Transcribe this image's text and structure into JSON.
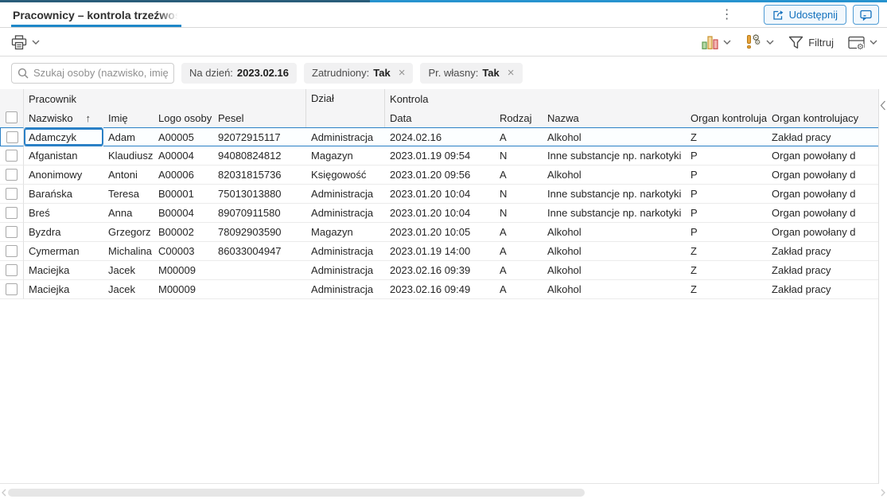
{
  "window": {
    "tab_title": "Pracownicy – kontrola trzeźwości",
    "share_label": "Udostępnij"
  },
  "toolbar": {
    "filter_label": "Filtruj"
  },
  "filters": {
    "search_placeholder": "Szukaj osoby (nazwisko, imię, l",
    "chips": [
      {
        "label": "Na dzień:",
        "value": "2023.02.16",
        "removable": false
      },
      {
        "label": "Zatrudniony:",
        "value": "Tak",
        "removable": true
      },
      {
        "label": "Pr. własny:",
        "value": "Tak",
        "removable": true
      }
    ],
    "chip_close_glyph": "×"
  },
  "table": {
    "group_headers": {
      "pracownik": "Pracownik",
      "dzial": "Dział",
      "kontrola": "Kontrola"
    },
    "columns": {
      "nazwisko": "Nazwisko",
      "sort_arrow": "↑",
      "imie": "Imię",
      "logo": "Logo osoby",
      "pesel": "Pesel",
      "data": "Data",
      "rodzaj": "Rodzaj",
      "nazwa": "Nazwa",
      "organ_kod": "Organ kontrolujacy",
      "organ_nazwa": "Organ kontrolujacy"
    },
    "rows": [
      {
        "nazwisko": "Adamczyk",
        "imie": "Adam",
        "logo": "A00005",
        "pesel": "92072915117",
        "dzial": "Administracja",
        "data": "2024.02.16",
        "rodzaj": "A",
        "nazwa": "Alkohol",
        "organ_kod": "Z",
        "organ_nazwa": "Zakład pracy"
      },
      {
        "nazwisko": "Afganistan",
        "imie": "Klaudiusz",
        "logo": "A00004",
        "pesel": "94080824812",
        "dzial": "Magazyn",
        "data": "2023.01.19 09:54",
        "rodzaj": "N",
        "nazwa": "Inne substancje np. narkotyki",
        "organ_kod": "P",
        "organ_nazwa": "Organ powołany d"
      },
      {
        "nazwisko": "Anonimowy",
        "imie": "Antoni",
        "logo": "A00006",
        "pesel": "82031815736",
        "dzial": "Księgowość",
        "data": "2023.01.20 09:56",
        "rodzaj": "A",
        "nazwa": "Alkohol",
        "organ_kod": "P",
        "organ_nazwa": "Organ powołany d"
      },
      {
        "nazwisko": "Barańska",
        "imie": "Teresa",
        "logo": "B00001",
        "pesel": "75013013880",
        "dzial": "Administracja",
        "data": "2023.01.20 10:04",
        "rodzaj": "N",
        "nazwa": "Inne substancje np. narkotyki",
        "organ_kod": "P",
        "organ_nazwa": "Organ powołany d"
      },
      {
        "nazwisko": "Breś",
        "imie": "Anna",
        "logo": "B00004",
        "pesel": "89070911580",
        "dzial": "Administracja",
        "data": "2023.01.20 10:04",
        "rodzaj": "N",
        "nazwa": "Inne substancje np. narkotyki",
        "organ_kod": "P",
        "organ_nazwa": "Organ powołany d"
      },
      {
        "nazwisko": "Byzdra",
        "imie": "Grzegorz",
        "logo": "B00002",
        "pesel": "78092903590",
        "dzial": "Magazyn",
        "data": "2023.01.20 10:05",
        "rodzaj": "A",
        "nazwa": "Alkohol",
        "organ_kod": "P",
        "organ_nazwa": "Organ powołany d"
      },
      {
        "nazwisko": "Cymerman",
        "imie": "Michalina",
        "logo": "C00003",
        "pesel": "86033004947",
        "dzial": "Administracja",
        "data": "2023.01.19 14:00",
        "rodzaj": "A",
        "nazwa": "Alkohol",
        "organ_kod": "Z",
        "organ_nazwa": "Zakład pracy"
      },
      {
        "nazwisko": "Maciejka",
        "imie": "Jacek",
        "logo": "M00009",
        "pesel": "",
        "dzial": "Administracja",
        "data": "2023.02.16 09:39",
        "rodzaj": "A",
        "nazwa": "Alkohol",
        "organ_kod": "Z",
        "organ_nazwa": "Zakład pracy"
      },
      {
        "nazwisko": "Maciejka",
        "imie": "Jacek",
        "logo": "M00009",
        "pesel": "",
        "dzial": "Administracja",
        "data": "2023.02.16 09:49",
        "rodzaj": "A",
        "nazwa": "Alkohol",
        "organ_kod": "Z",
        "organ_nazwa": "Zakład pracy"
      }
    ]
  },
  "icons": {
    "overflow_menu": "⋮",
    "gear": "⚙",
    "sort_ascending": "↑"
  },
  "colors": {
    "accent_blue": "#1e87c8",
    "focus_blue": "#2a80c6",
    "button_blue": "#1270bd",
    "chip_bg": "#f1f1f2",
    "header_bg": "#f5f5f6",
    "chart_green": "#71ad62",
    "chart_amber": "#e0a43f",
    "chart_red": "#d4504c",
    "alert_orange": "#e8a43c",
    "strip_dark": "#2a5d7a",
    "strip_light": "#2793cf"
  }
}
